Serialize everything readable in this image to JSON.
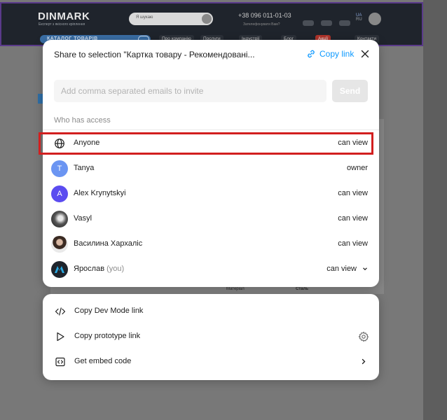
{
  "background_site": {
    "logo": "DINMARK",
    "logo_tagline": "Експерт з якісного кріплення",
    "search_placeholder": "Я шукаю",
    "phone": "+38 096 011-01-03",
    "phone_sub": "Зателефонувати Вам?",
    "lang": "UA",
    "lang2": "RU",
    "catalog_label": "КАТАЛОГ ТОВАРІВ",
    "nav": [
      "Про компанію",
      "Послуги",
      "Індустрії",
      "Блог",
      "Акції",
      "Контакти"
    ],
    "table_label": "Матеріал",
    "table_value": "Сталь"
  },
  "modal": {
    "title": "Share to selection \"Картка товару - Рекомендовані...",
    "copy_link_label": "Copy link",
    "invite_placeholder": "Add comma separated emails to invite",
    "send_label": "Send",
    "access_heading": "Who has access"
  },
  "access_list": [
    {
      "name": "Anyone",
      "role": "can view",
      "avatar": "globe-icon",
      "highlighted": true
    },
    {
      "name": "Tanya",
      "initial": "T",
      "role": "owner",
      "avatar_color": "#6b95f2"
    },
    {
      "name": "Alex Krynytskyi",
      "initial": "A",
      "role": "can view",
      "avatar_color": "#5b4cf0"
    },
    {
      "name": "Vasyl",
      "role": "can view",
      "avatar": "photo"
    },
    {
      "name": "Василина Хархаліс",
      "role": "can view",
      "avatar": "photo"
    },
    {
      "name": "Ярослав",
      "suffix": "(you)",
      "role": "can view",
      "avatar": "logo",
      "has_dropdown": true
    }
  ],
  "actions": [
    {
      "label": "Copy Dev Mode link",
      "icon": "code-icon"
    },
    {
      "label": "Copy prototype link",
      "icon": "play-icon",
      "trailing": "gear-icon"
    },
    {
      "label": "Get embed code",
      "icon": "embed-icon",
      "trailing": "chevron-right-icon"
    }
  ]
}
